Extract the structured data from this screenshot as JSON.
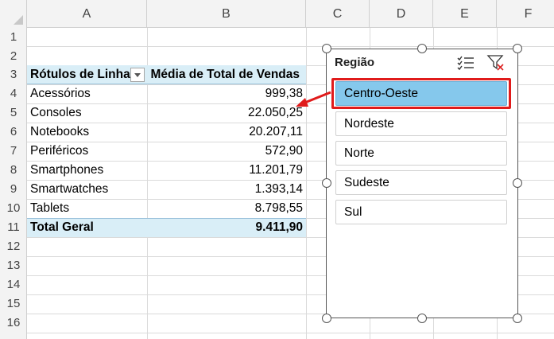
{
  "columns": [
    "A",
    "B",
    "C",
    "D",
    "E",
    "F"
  ],
  "rows": [
    "1",
    "2",
    "3",
    "4",
    "5",
    "6",
    "7",
    "8",
    "9",
    "10",
    "11",
    "12",
    "13",
    "14",
    "15",
    "16"
  ],
  "pivot": {
    "header_rows": "Rótulos de Linha",
    "header_values": "Média de Total de Vendas",
    "items": [
      {
        "label": "Acessórios",
        "value": "999,38"
      },
      {
        "label": "Consoles",
        "value": "22.050,25"
      },
      {
        "label": "Notebooks",
        "value": "20.207,11"
      },
      {
        "label": "Periféricos",
        "value": "572,90"
      },
      {
        "label": "Smartphones",
        "value": "11.201,79"
      },
      {
        "label": "Smartwatches",
        "value": "1.393,14"
      },
      {
        "label": "Tablets",
        "value": "8.798,55"
      }
    ],
    "total_label": "Total Geral",
    "total_value": "9.411,90"
  },
  "slicer": {
    "title": "Região",
    "items": [
      {
        "label": "Centro-Oeste",
        "selected": true
      },
      {
        "label": "Nordeste",
        "selected": false
      },
      {
        "label": "Norte",
        "selected": false
      },
      {
        "label": "Sudeste",
        "selected": false
      },
      {
        "label": "Sul",
        "selected": false
      }
    ],
    "multi_select_icon": "multi-select-icon",
    "clear_filter_icon": "clear-filter-icon"
  },
  "colors": {
    "selected_item": "#85c8ec",
    "highlight": "#e01b1b",
    "pivot_header": "#d9eef7"
  }
}
